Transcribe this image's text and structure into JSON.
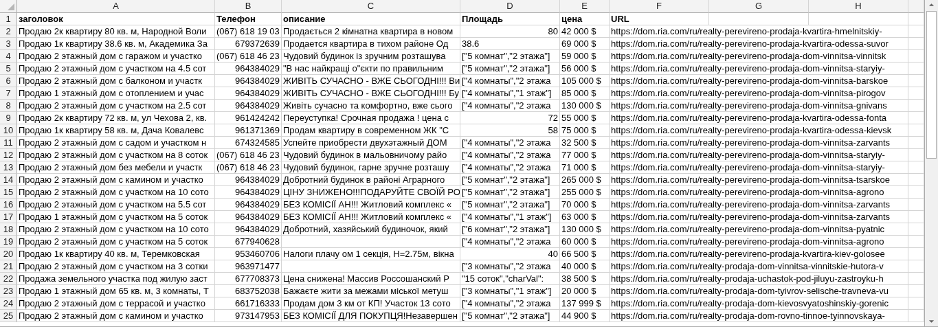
{
  "column_headers": [
    "A",
    "B",
    "C",
    "D",
    "E",
    "F",
    "G",
    "H"
  ],
  "header_row": {
    "number": "1",
    "cells": [
      "заголовок",
      "Телефон",
      "описание",
      "Площадь",
      "цена",
      "URL"
    ]
  },
  "rows": [
    {
      "number": "2",
      "title": "Продаю 2к квартиру 80 кв. м, Народной Воли",
      "phone": {
        "text": "(067) 618 19 03",
        "kind": "text"
      },
      "description": "Продається 2 кімнатна квартира в новом",
      "area": {
        "text": "80",
        "kind": "number"
      },
      "price": "42 000 $",
      "url": "https://dom.ria.com/ru/realty-perevireno-prodaja-kvartira-hmelnitskiy-"
    },
    {
      "number": "3",
      "title": "Продаю 1к квартиру 38.6 кв. м, Академика За",
      "phone": {
        "text": "679372639",
        "kind": "number"
      },
      "description": "Продается квартира в тихом районе Од",
      "area": {
        "text": "38.6",
        "kind": "text"
      },
      "price": "69 000 $",
      "url": "https://dom.ria.com/ru/realty-perevireno-prodaja-kvartira-odessa-suvor"
    },
    {
      "number": "4",
      "title": "Продаю 2 этажный дом с гаражом и участко",
      "phone": {
        "text": "(067) 618 46 23",
        "kind": "text"
      },
      "description": "Чудовий будинок із зручним розташува",
      "area": {
        "text": "[\"5 комнат\",\"2 этажа\"]",
        "kind": "text"
      },
      "price": "59 000 $",
      "url": "https://dom.ria.com/ru/realty-perevireno-prodaja-dom-vinnitsa-vinnitsk"
    },
    {
      "number": "5",
      "title": "Продаю 2 этажный дом с участком на 4.5 сот",
      "phone": {
        "text": "964384029",
        "kind": "number"
      },
      "description": "\"В нас найкращі о\"єкти по правильним",
      "area": {
        "text": "[\"5 комнат\",\"2 этажа\"]",
        "kind": "text"
      },
      "price": "56 000 $",
      "url": "https://dom.ria.com/ru/realty-perevireno-prodaja-dom-vinnitsa-staryiy-"
    },
    {
      "number": "6",
      "title": "Продаю 2 этажный дом с балконом и участк",
      "phone": {
        "text": "964384029",
        "kind": "number"
      },
      "description": "ЖИВІТЬ СУЧАСНО - ВЖЕ СЬОГОДНІ!!! Ви",
      "area": {
        "text": "[\"4 комнаты\",\"2 этажа",
        "kind": "text"
      },
      "price": "105 000 $",
      "url": "https://dom.ria.com/ru/realty-perevireno-prodaja-dom-vinnitsa-barskoe"
    },
    {
      "number": "7",
      "title": "Продаю 1 этажный дом с отоплением и учас",
      "phone": {
        "text": "964384029",
        "kind": "number"
      },
      "description": "ЖИВІТЬ СУЧАСНО - ВЖЕ СЬОГОДНІ!!! Бу",
      "area": {
        "text": "[\"4 комнаты\",\"1 этаж\"]",
        "kind": "text"
      },
      "price": "85 000 $",
      "url": "https://dom.ria.com/ru/realty-perevireno-prodaja-dom-vinnitsa-pirogov"
    },
    {
      "number": "8",
      "title": "Продаю 2 этажный дом с участком на 2.5 сот",
      "phone": {
        "text": "964384029",
        "kind": "number"
      },
      "description": "Живіть сучасно та комфортно, вже сього",
      "area": {
        "text": "[\"4 комнаты\",\"2 этажа",
        "kind": "text"
      },
      "price": "130 000 $",
      "url": "https://dom.ria.com/ru/realty-perevireno-prodaja-dom-vinnitsa-gnivans"
    },
    {
      "number": "9",
      "title": "Продаю 2к квартиру 72 кв. м, ул Чехова 2, кв.",
      "phone": {
        "text": "961424242",
        "kind": "number"
      },
      "description": "Переуступка! Срочная продажа ! цена с",
      "area": {
        "text": "72",
        "kind": "number"
      },
      "price": "55 000 $",
      "url": "https://dom.ria.com/ru/realty-perevireno-prodaja-kvartira-odessa-fonta"
    },
    {
      "number": "10",
      "title": "Продаю 1к квартиру 58 кв. м, Дача Ковалевс",
      "phone": {
        "text": "961371369",
        "kind": "number"
      },
      "description": "Продам квартиру в современном  ЖК \"С",
      "area": {
        "text": "58",
        "kind": "number"
      },
      "price": "75 000 $",
      "url": "https://dom.ria.com/ru/realty-perevireno-prodaja-kvartira-odessa-kievsk"
    },
    {
      "number": "11",
      "title": "Продаю 2 этажный дом с садом и участком н",
      "phone": {
        "text": "674324585",
        "kind": "number"
      },
      "description": "Успейте приобрести  двухэтажный ДОМ",
      "area": {
        "text": "[\"4 комнаты\",\"2 этажа",
        "kind": "text"
      },
      "price": "32 500 $",
      "url": "https://dom.ria.com/ru/realty-perevireno-prodaja-dom-vinnitsa-zarvants"
    },
    {
      "number": "12",
      "title": "Продаю 2 этажный дом с участком на 8 соток",
      "phone": {
        "text": "(067) 618 46 23",
        "kind": "text"
      },
      "description": "Чудовий будинок в мальовничому райо",
      "area": {
        "text": "[\"4 комнаты\",\"2 этажа",
        "kind": "text"
      },
      "price": "77 000 $",
      "url": "https://dom.ria.com/ru/realty-perevireno-prodaja-dom-vinnitsa-staryiy-"
    },
    {
      "number": "13",
      "title": "Продаю 2 этажный дом без мебели и участк",
      "phone": {
        "text": "(067) 618 46 23",
        "kind": "text"
      },
      "description": "Чудовий будинок, гарне зручне розташу",
      "area": {
        "text": "[\"4 комнаты\",\"2 этажа",
        "kind": "text"
      },
      "price": "71 000 $",
      "url": "https://dom.ria.com/ru/realty-perevireno-prodaja-dom-vinnitsa-staryiy-"
    },
    {
      "number": "14",
      "title": "Продаю 2 этажный дом с камином и участко",
      "phone": {
        "text": "964384029",
        "kind": "number"
      },
      "description": "Добротний будинок в районі Аграрного",
      "area": {
        "text": "[\"5 комнат\",\"2 этажа\"]",
        "kind": "text"
      },
      "price": "265 000 $",
      "url": "https://dom.ria.com/ru/realty-perevireno-prodaja-dom-vinnitsa-tsarskoe"
    },
    {
      "number": "15",
      "title": "Продаю 2 этажный дом с участком на 10 сото",
      "phone": {
        "text": "964384029",
        "kind": "number"
      },
      "description": "ЦІНУ ЗНИЖЕНО!!!ПОДАРУЙТЕ СВОЇЙ РО",
      "area": {
        "text": "[\"5 комнат\",\"2 этажа\"]",
        "kind": "text"
      },
      "price": "255 000 $",
      "url": "https://dom.ria.com/ru/realty-perevireno-prodaja-dom-vinnitsa-agrono"
    },
    {
      "number": "16",
      "title": "Продаю 2 этажный дом с участком на 5.5 сот",
      "phone": {
        "text": "964384029",
        "kind": "number"
      },
      "description": "БЕЗ КОМІСІЇ АН!!! Житловий комплекс «",
      "area": {
        "text": "[\"5 комнат\",\"2 этажа\"]",
        "kind": "text"
      },
      "price": "70 000 $",
      "url": "https://dom.ria.com/ru/realty-perevireno-prodaja-dom-vinnitsa-zarvants"
    },
    {
      "number": "17",
      "title": "Продаю 1 этажный дом с участком на 5 соток",
      "phone": {
        "text": "964384029",
        "kind": "number"
      },
      "description": "БЕЗ КОМІСІЇ АН!!! Житловий комплекс «",
      "area": {
        "text": "[\"4 комнаты\",\"1 этаж\"]",
        "kind": "text"
      },
      "price": "63 000 $",
      "url": "https://dom.ria.com/ru/realty-perevireno-prodaja-dom-vinnitsa-zarvants"
    },
    {
      "number": "18",
      "title": "Продаю 2 этажный дом с участком на 10 сото",
      "phone": {
        "text": "964384029",
        "kind": "number"
      },
      "description": "Добротний, хазяйський будиночок, який",
      "area": {
        "text": "[\"6 комнат\",\"2 этажа\"]",
        "kind": "text"
      },
      "price": "130 000 $",
      "url": "https://dom.ria.com/ru/realty-perevireno-prodaja-dom-vinnitsa-pyatnic"
    },
    {
      "number": "19",
      "title": "Продаю 2 этажный дом с участком на 5 соток",
      "phone": {
        "text": "677940628",
        "kind": "number"
      },
      "area": {
        "text": "[\"4 комнаты\",\"2 этажа",
        "kind": "text"
      },
      "price": "60 000 $",
      "url": "https://dom.ria.com/ru/realty-perevireno-prodaja-dom-vinnitsa-agrono"
    },
    {
      "number": "20",
      "title": "Продаю 1к квартиру 40 кв. м, Теремковская",
      "phone": {
        "text": "953460706",
        "kind": "number"
      },
      "description": "Налоги плачу ом 1 секція, Н=2.75м, вікна",
      "area": {
        "text": "40",
        "kind": "number"
      },
      "price": "66 500 $",
      "url": "https://dom.ria.com/ru/realty-perevireno-prodaja-kvartira-kiev-golosee"
    },
    {
      "number": "21",
      "title": "Продаю 2 этажный дом с участком на 3 сотки",
      "phone": {
        "text": "963971477",
        "kind": "number"
      },
      "area": {
        "text": "[\"3 комнаты\",\"2 этажа",
        "kind": "text"
      },
      "price": "40 000 $",
      "url": "https://dom.ria.com/ru/realty-prodaja-dom-vinnitsa-vinnitskie-hutora-v"
    },
    {
      "number": "22",
      "title": "Продажа земельного участка под жилую заст",
      "phone": {
        "text": "677708373",
        "kind": "number"
      },
      "description": "Цена снижена!  Массив Россошанский Р",
      "area": {
        "text": "\"15 соток\",\"charVal\":",
        "kind": "text"
      },
      "price": "38 500 $",
      "url": "https://dom.ria.com/ru/realty-prodaja-uchastok-pod-jiluyu-zastroyku-h"
    },
    {
      "number": "23",
      "title": "Продаю 1 этажный дом 65 кв. м, 3 комнаты, Т",
      "phone": {
        "text": "683752038",
        "kind": "number"
      },
      "description": "Бажаєте жити за межами міської метуш",
      "area": {
        "text": "[\"3 комнаты\",\"1 этаж\"]",
        "kind": "text"
      },
      "price": "20 000 $",
      "url": "https://dom.ria.com/ru/realty-prodaja-dom-tyivrov-selische-travneva-vu"
    },
    {
      "number": "24",
      "title": "Продаю 2 этажный дом с террасой и участко",
      "phone": {
        "text": "661716333",
        "kind": "number"
      },
      "description": "Продам дом 3 км от КП! Участок 13 сото",
      "area": {
        "text": "[\"4 комнаты\",\"2 этажа",
        "kind": "text"
      },
      "price": "137 999 $",
      "url": "https://dom.ria.com/ru/realty-prodaja-dom-kievosvyatoshinskiy-gorenic"
    },
    {
      "number": "25",
      "title": "Продаю 2 этажный дом с камином и участко",
      "phone": {
        "text": "973147953",
        "kind": "number"
      },
      "description": "БЕЗ КОМІСІЇ ДЛЯ ПОКУПЦЯ!Незавершен",
      "area": {
        "text": "[\"5 комнат\",\"2 этажа\"]",
        "kind": "text"
      },
      "price": "44 900 $",
      "url": "https://dom.ria.com/ru/realty-prodaja-dom-rovno-tinnoe-tyinnovskaya-"
    }
  ]
}
